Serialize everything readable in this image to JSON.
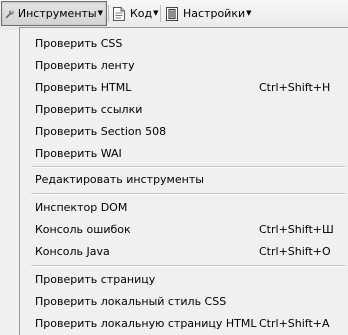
{
  "toolbar": {
    "tools_label": "Инструменты",
    "code_label": "Код",
    "settings_label": "Настройки"
  },
  "menu": {
    "items": [
      {
        "label": "Проверить CSS",
        "shortcut": ""
      },
      {
        "label": "Проверить ленту",
        "shortcut": ""
      },
      {
        "label": "Проверить HTML",
        "shortcut": "Ctrl+Shift+H"
      },
      {
        "label": "Проверить ссылки",
        "shortcut": ""
      },
      {
        "label": "Проверить Section 508",
        "shortcut": ""
      },
      {
        "label": "Проверить WAI",
        "shortcut": ""
      },
      {
        "label": "Редактировать инструменты",
        "shortcut": ""
      },
      {
        "label": "Инспектор DOM",
        "shortcut": ""
      },
      {
        "label": "Консоль ошибок",
        "shortcut": "Ctrl+Shift+Ш"
      },
      {
        "label": "Консоль Java",
        "shortcut": "Ctrl+Shift+O"
      },
      {
        "label": "Проверить страницу",
        "shortcut": ""
      },
      {
        "label": "Проверить локальный стиль CSS",
        "shortcut": ""
      },
      {
        "label": "Проверить локальную страницу HTML",
        "shortcut": "Ctrl+Shift+A"
      }
    ]
  },
  "icons": {
    "tools": "wrench-icon",
    "code": "code-document-icon",
    "settings": "settings-icon"
  }
}
